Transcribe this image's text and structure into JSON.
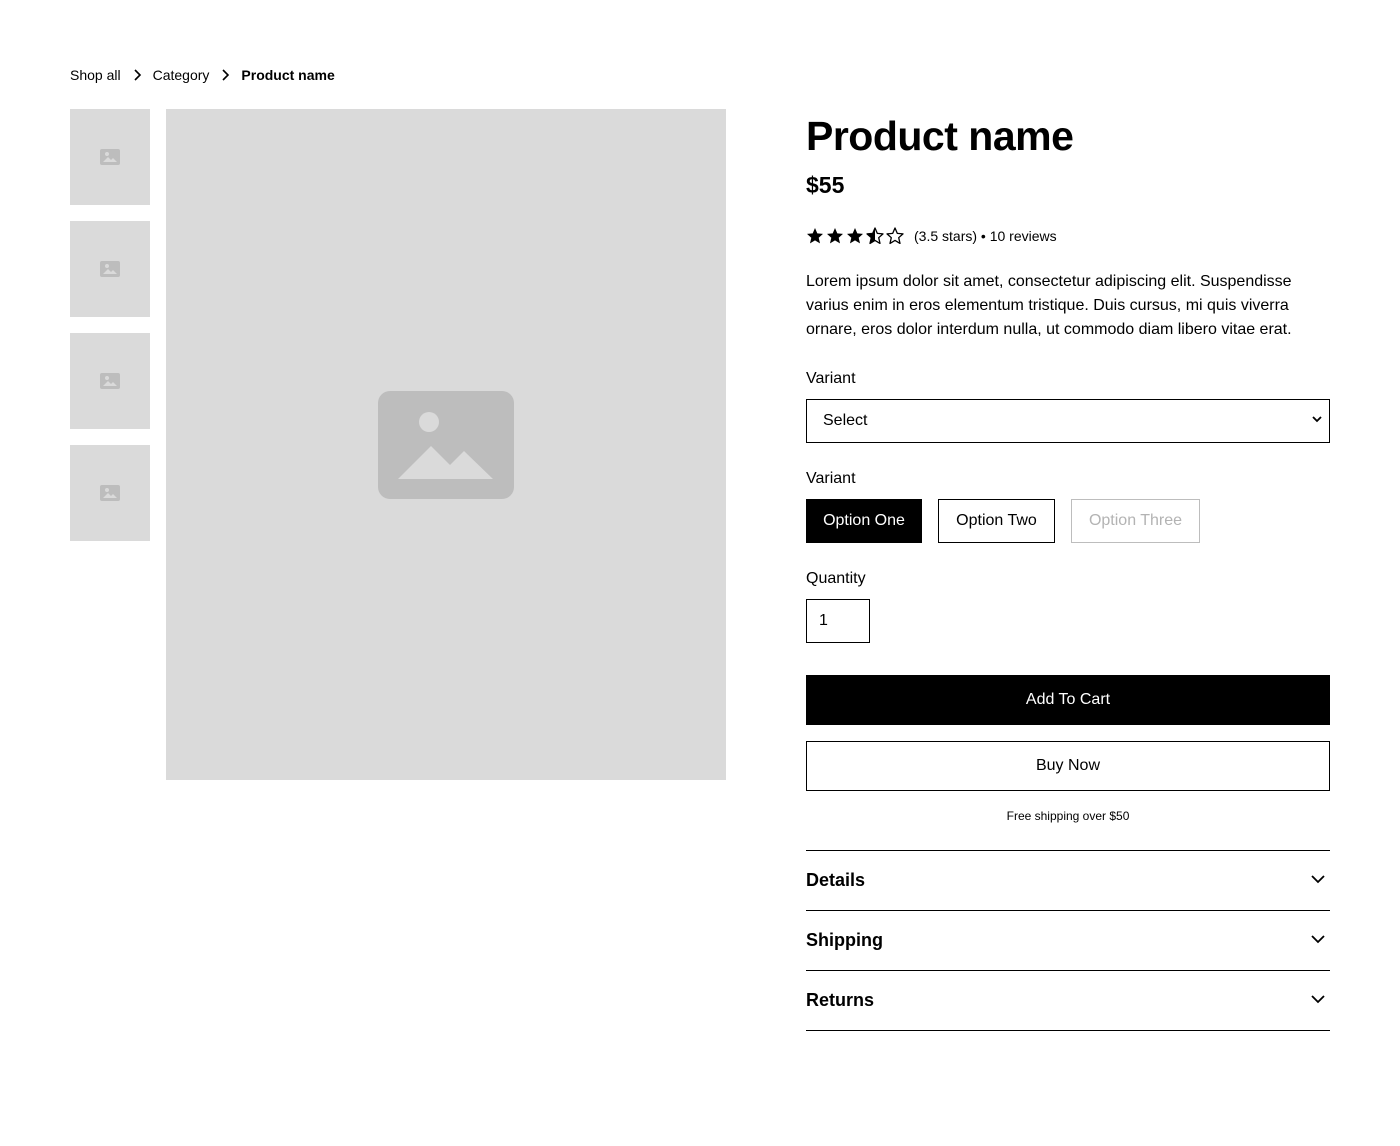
{
  "breadcrumb": {
    "items": [
      "Shop all",
      "Category"
    ],
    "current": "Product name"
  },
  "gallery": {
    "thumbnail_count": 4,
    "icon": "image-placeholder-icon",
    "placeholder_color": "#dadada"
  },
  "product": {
    "name": "Product name",
    "price": "$55",
    "rating": 3.5,
    "rating_max": 5,
    "rating_text": "(3.5 stars) • 10 reviews",
    "description": "Lorem ipsum dolor sit amet, consectetur adipiscing elit. Suspendisse varius enim in eros elementum tristique. Duis cursus, mi quis viverra ornare, eros dolor interdum nulla, ut commodo diam libero vitae erat."
  },
  "variant_select": {
    "label": "Variant",
    "value": "Select"
  },
  "variant_options": {
    "label": "Variant",
    "options": [
      {
        "label": "Option One",
        "state": "selected"
      },
      {
        "label": "Option Two",
        "state": "default"
      },
      {
        "label": "Option Three",
        "state": "disabled"
      }
    ]
  },
  "quantity": {
    "label": "Quantity",
    "value": "1"
  },
  "actions": {
    "add_to_cart": "Add To Cart",
    "buy_now": "Buy Now",
    "shipping_note": "Free shipping over $50"
  },
  "accordion": [
    {
      "title": "Details",
      "icon": "chevron-down-icon"
    },
    {
      "title": "Shipping",
      "icon": "chevron-down-icon"
    },
    {
      "title": "Returns",
      "icon": "chevron-down-icon"
    }
  ],
  "colors": {
    "primary": "#000000",
    "background": "#ffffff",
    "placeholder": "#dadada",
    "placeholder_icon": "#bdbdbd",
    "disabled_text": "#b3b3b3"
  }
}
